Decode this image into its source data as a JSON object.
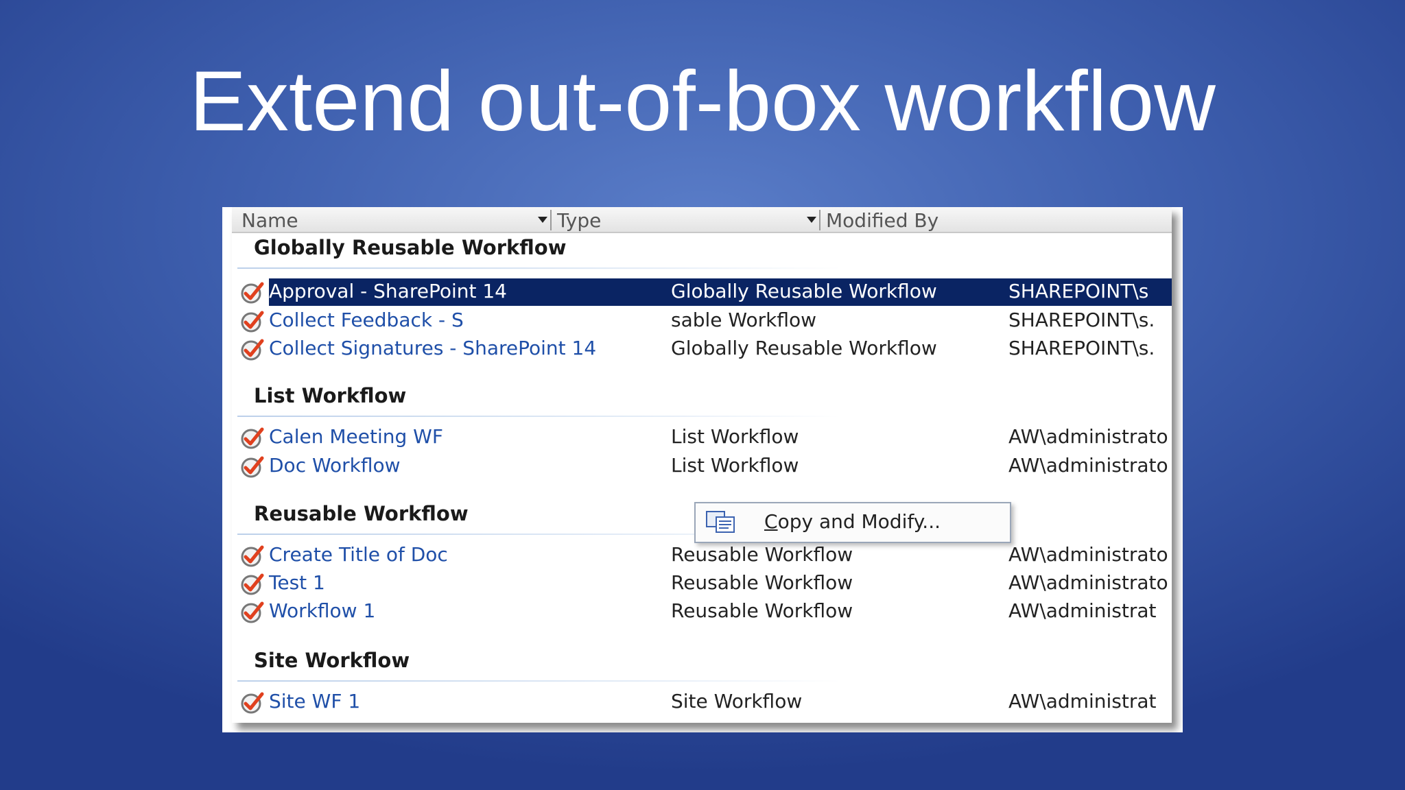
{
  "slide": {
    "title": "Extend out-of-box workflow"
  },
  "columns": {
    "name": "Name",
    "type": "Type",
    "modified_by": "Modified By"
  },
  "groups": [
    {
      "label": "Globally Reusable Workflow",
      "rows": [
        {
          "name": "Approval - SharePoint 14",
          "type": "Globally Reusable Workflow",
          "modified_by": "SHAREPOINT\\s",
          "selected": true
        },
        {
          "name": "Collect Feedback - S",
          "type": "sable Workflow",
          "modified_by": "SHAREPOINT\\s."
        },
        {
          "name": "Collect Signatures - SharePoint 14",
          "type": "Globally Reusable Workflow",
          "modified_by": "SHAREPOINT\\s."
        }
      ]
    },
    {
      "label": "List Workflow",
      "rows": [
        {
          "name": "Calen Meeting WF",
          "type": "List Workflow",
          "modified_by": "AW\\administrato"
        },
        {
          "name": "Doc Workflow",
          "type": "List Workflow",
          "modified_by": "AW\\administrato"
        }
      ]
    },
    {
      "label": "Reusable Workflow",
      "rows": [
        {
          "name": "Create Title of Doc",
          "type": "Reusable Workflow",
          "modified_by": "AW\\administrato"
        },
        {
          "name": "Test 1",
          "type": "Reusable Workflow",
          "modified_by": "AW\\administrato"
        },
        {
          "name": "Workflow 1",
          "type": "Reusable Workflow",
          "modified_by": "AW\\administrat"
        }
      ]
    },
    {
      "label": "Site Workflow",
      "rows": [
        {
          "name": "Site WF 1",
          "type": "Site Workflow",
          "modified_by": "AW\\administrat"
        }
      ]
    }
  ],
  "context_menu": {
    "item_label": "Copy and Modify...",
    "accelerator": "C",
    "item_rest": "opy and Modify..."
  },
  "icons": {
    "workflow": "workflow-check-icon",
    "copy": "copy-icon",
    "sort": "dropdown-arrow-icon"
  },
  "colors": {
    "selection": "#0a2463",
    "link": "#1f4fa8",
    "checkmark": "#e0401e"
  }
}
